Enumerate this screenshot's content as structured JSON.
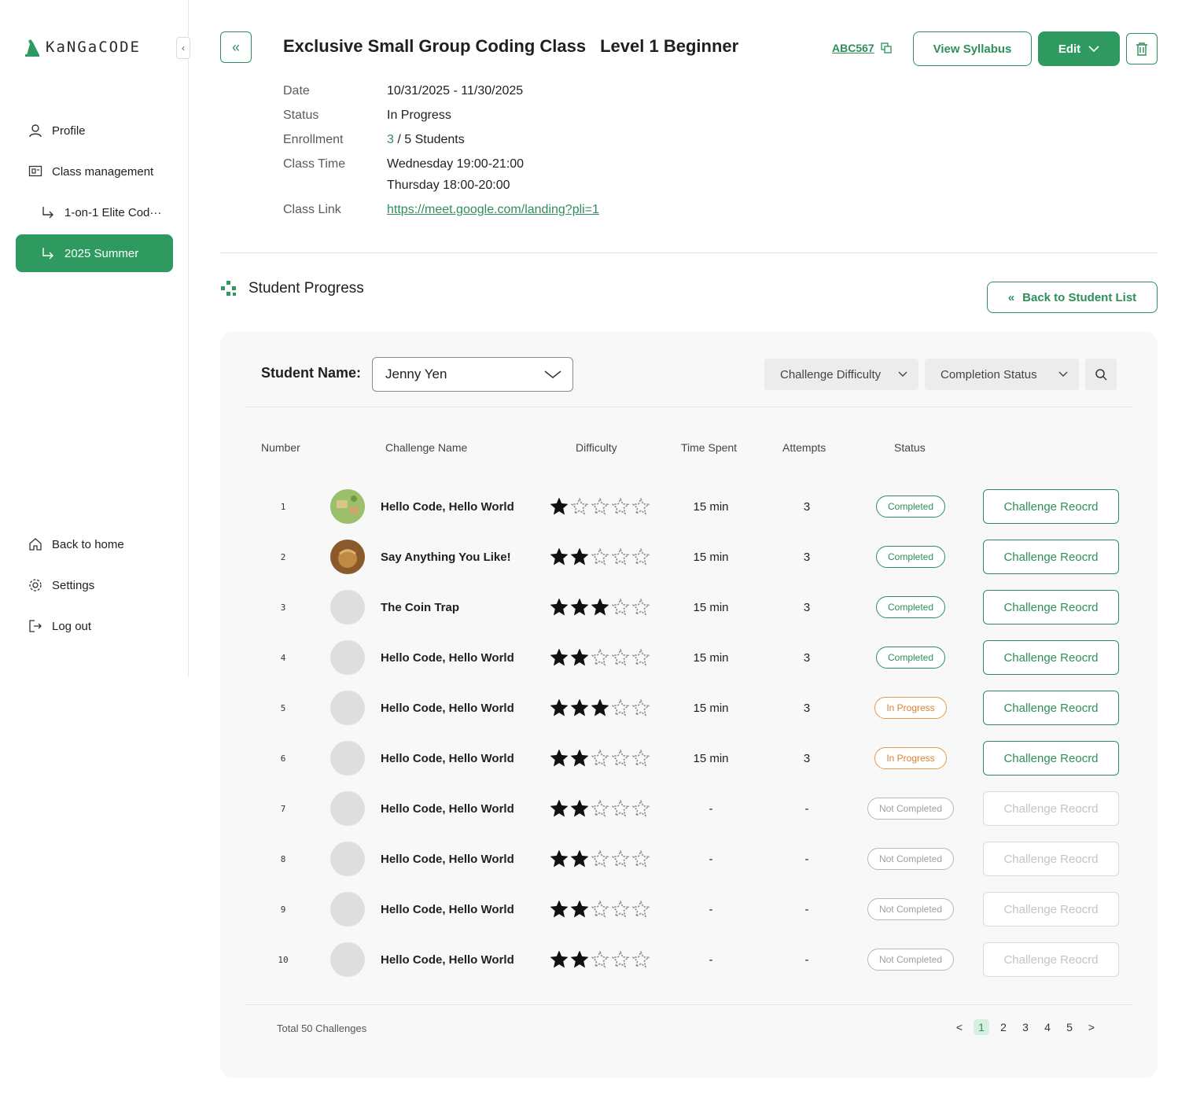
{
  "app": {
    "logo_text": "KaNGaCODE"
  },
  "sidebar": {
    "items": [
      {
        "label": "Profile",
        "icon": "user-icon"
      },
      {
        "label": "Class management",
        "icon": "classroom-icon"
      },
      {
        "label": "1-on-1 Elite Cod···",
        "icon": "sub-arrow-icon"
      },
      {
        "label": "2025 Summer",
        "icon": "sub-arrow-icon",
        "active": true
      }
    ],
    "bottom": [
      {
        "label": "Back to home",
        "icon": "home-icon"
      },
      {
        "label": "Settings",
        "icon": "gear-icon"
      },
      {
        "label": "Log out",
        "icon": "logout-icon"
      }
    ]
  },
  "header": {
    "title": "Exclusive Small Group Coding Class",
    "level": "Level 1 Beginner",
    "class_code": "ABC567",
    "view_syllabus": "View Syllabus",
    "edit": "Edit"
  },
  "info": {
    "date_label": "Date",
    "date": "10/31/2025 - 11/30/2025",
    "status_label": "Status",
    "status": "In Progress",
    "enrollment_label": "Enrollment",
    "enrolled": "3",
    "enrollment_rest": " / 5 Students",
    "class_time_label": "Class Time",
    "class_time_1": "Wednesday 19:00-21:00",
    "class_time_2": "Thursday 18:00-20:00",
    "class_link_label": "Class Link",
    "class_link": "https://meet.google.com/landing?pli=1"
  },
  "progress": {
    "section_title": "Student Progress",
    "back_to_list": "Back to Student List",
    "student_label": "Student Name:",
    "student_value": "Jenny Yen",
    "filter_difficulty": "Challenge Difficulty",
    "filter_status": "Completion Status",
    "columns": [
      "Number",
      "Challenge Name",
      "Difficulty",
      "Time Spent",
      "Attempts",
      "Status"
    ],
    "rows": [
      {
        "number": "1",
        "name": "Hello Code, Hello World",
        "difficulty": 1,
        "time": "15 min",
        "attempts": "3",
        "status": "Completed",
        "status_kind": "completed",
        "thumb": "map"
      },
      {
        "number": "2",
        "name": "Say Anything You Like!",
        "difficulty": 2,
        "time": "15 min",
        "attempts": "3",
        "status": "Completed",
        "status_kind": "completed",
        "thumb": "coin"
      },
      {
        "number": "3",
        "name": "The Coin Trap",
        "difficulty": 3,
        "time": "15 min",
        "attempts": "3",
        "status": "Completed",
        "status_kind": "completed",
        "thumb": ""
      },
      {
        "number": "4",
        "name": "Hello Code, Hello World",
        "difficulty": 2,
        "time": "15 min",
        "attempts": "3",
        "status": "Completed",
        "status_kind": "completed",
        "thumb": ""
      },
      {
        "number": "5",
        "name": "Hello Code, Hello World",
        "difficulty": 3,
        "time": "15 min",
        "attempts": "3",
        "status": "In Progress",
        "status_kind": "progress",
        "thumb": ""
      },
      {
        "number": "6",
        "name": "Hello Code, Hello World",
        "difficulty": 2,
        "time": "15 min",
        "attempts": "3",
        "status": "In Progress",
        "status_kind": "progress",
        "thumb": ""
      },
      {
        "number": "7",
        "name": "Hello Code, Hello World",
        "difficulty": 2,
        "time": "-",
        "attempts": "-",
        "status": "Not Completed",
        "status_kind": "notdone",
        "thumb": ""
      },
      {
        "number": "8",
        "name": "Hello Code, Hello World",
        "difficulty": 2,
        "time": "-",
        "attempts": "-",
        "status": "Not Completed",
        "status_kind": "notdone",
        "thumb": ""
      },
      {
        "number": "9",
        "name": "Hello Code, Hello World",
        "difficulty": 2,
        "time": "-",
        "attempts": "-",
        "status": "Not Completed",
        "status_kind": "notdone",
        "thumb": ""
      },
      {
        "number": "10",
        "name": "Hello Code, Hello World",
        "difficulty": 2,
        "time": "-",
        "attempts": "-",
        "status": "Not Completed",
        "status_kind": "notdone",
        "thumb": ""
      }
    ],
    "record_label": "Challenge Reocrd",
    "max_difficulty": 5,
    "total": "Total 50 Challenges",
    "pages": [
      "1",
      "2",
      "3",
      "4",
      "5"
    ],
    "current_page": "1",
    "prev": "<",
    "next": ">"
  },
  "colors": {
    "accent": "#2e9a5f",
    "in_progress": "#d9822b",
    "muted": "#a0a0a0"
  }
}
